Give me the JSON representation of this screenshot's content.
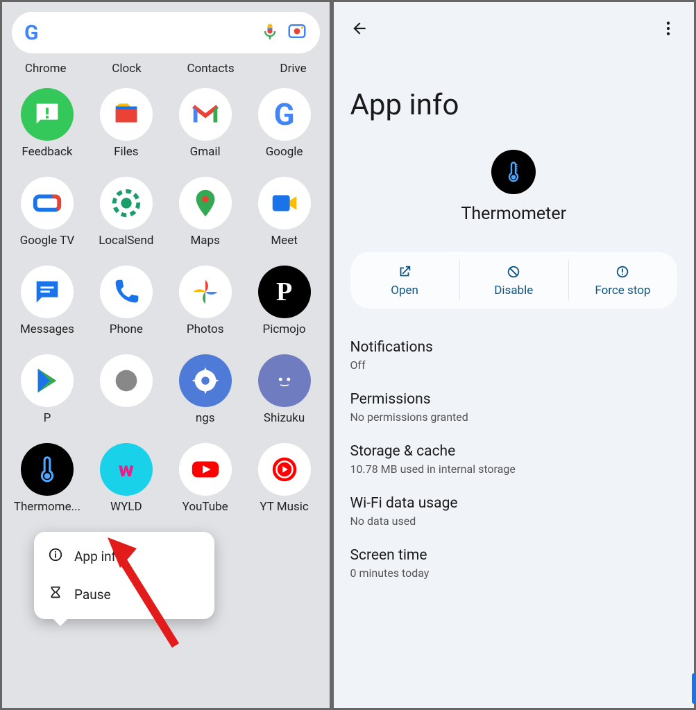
{
  "left_panel": {
    "first_row_labels": [
      "Chrome",
      "Clock",
      "Contacts",
      "Drive"
    ],
    "apps": [
      {
        "label": "Feedback",
        "bg": "#34c759",
        "icon": "feedback-icon"
      },
      {
        "label": "Files",
        "bg": "#fff",
        "icon": "files-icon"
      },
      {
        "label": "Gmail",
        "bg": "#fff",
        "icon": "gmail-icon"
      },
      {
        "label": "Google",
        "bg": "#fff",
        "icon": "google-icon"
      },
      {
        "label": "Google TV",
        "bg": "#fff",
        "icon": "googletv-icon"
      },
      {
        "label": "LocalSend",
        "bg": "#fff",
        "icon": "localsend-icon"
      },
      {
        "label": "Maps",
        "bg": "#fff",
        "icon": "maps-icon"
      },
      {
        "label": "Meet",
        "bg": "#fff",
        "icon": "meet-icon"
      },
      {
        "label": "Messages",
        "bg": "#fff",
        "icon": "messages-icon"
      },
      {
        "label": "Phone",
        "bg": "#fff",
        "icon": "phone-icon"
      },
      {
        "label": "Photos",
        "bg": "#fff",
        "icon": "photos-icon"
      },
      {
        "label": "Picmojo",
        "bg": "#000",
        "icon": "picmojo-icon"
      },
      {
        "label": "P",
        "bg": "#fff",
        "icon": "play-icon"
      },
      {
        "label": "",
        "bg": "#fff",
        "icon": "unknown-icon"
      },
      {
        "label": "ngs",
        "bg": "#4f7bd8",
        "icon": "settings-icon"
      },
      {
        "label": "Shizuku",
        "bg": "#6f7cc0",
        "icon": "shizuku-icon"
      },
      {
        "label": "Thermome...",
        "bg": "#000",
        "icon": "thermometer-icon"
      },
      {
        "label": "WYLD",
        "bg": "#19d1e8",
        "icon": "wyld-icon"
      },
      {
        "label": "YouTube",
        "bg": "#fff",
        "icon": "youtube-icon"
      },
      {
        "label": "YT Music",
        "bg": "#fff",
        "icon": "ytmusic-icon"
      }
    ],
    "popup": {
      "items": [
        {
          "label": "App info",
          "icon": "info-icon"
        },
        {
          "label": "Pause",
          "icon": "hourglass-icon"
        }
      ]
    }
  },
  "right_panel": {
    "title": "App info",
    "app_name": "Thermometer",
    "actions": {
      "open": "Open",
      "disable": "Disable",
      "force_stop": "Force stop"
    },
    "list": [
      {
        "title": "Notifications",
        "sub": "Off"
      },
      {
        "title": "Permissions",
        "sub": "No permissions granted"
      },
      {
        "title": "Storage & cache",
        "sub": "10.78 MB used in internal storage"
      },
      {
        "title": "Wi-Fi data usage",
        "sub": "No data used"
      },
      {
        "title": "Screen time",
        "sub": "0 minutes today"
      }
    ]
  }
}
